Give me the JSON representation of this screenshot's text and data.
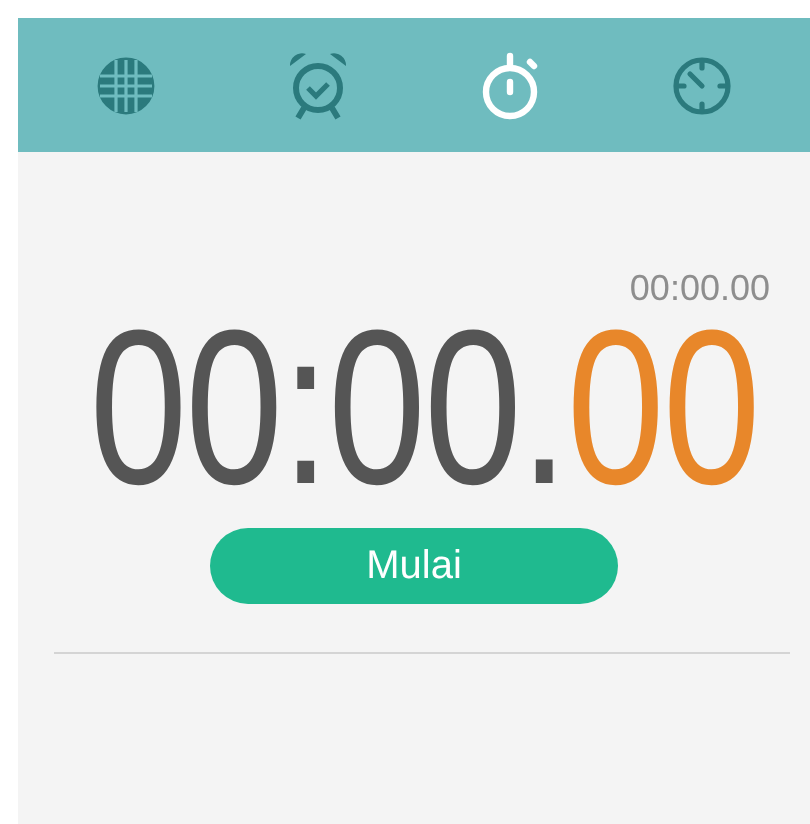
{
  "tabs": [
    {
      "kind": "world",
      "selected": false
    },
    {
      "kind": "alarm",
      "selected": false
    },
    {
      "kind": "stopwatch",
      "selected": true
    },
    {
      "kind": "timer",
      "selected": false
    }
  ],
  "lap_time": "00:00.00",
  "time": {
    "main": "00:00.",
    "hundredths": "00"
  },
  "start_button": "Mulai"
}
